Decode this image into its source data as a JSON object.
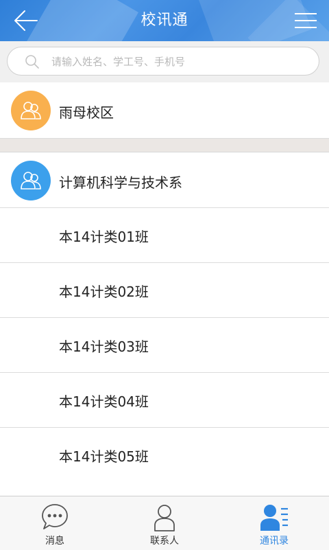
{
  "header": {
    "title": "校讯通"
  },
  "search": {
    "placeholder": "请输入姓名、学工号、手机号"
  },
  "campus": {
    "name": "雨母校区",
    "color": "#f9b04e"
  },
  "department": {
    "name": "计算机科学与技术系",
    "color": "#3ca0ec",
    "classes": [
      "本14计类01班",
      "本14计类02班",
      "本14计类03班",
      "本14计类04班",
      "本14计类05班"
    ]
  },
  "tabbar": {
    "items": [
      {
        "label": "消息",
        "icon": "chat-bubble-icon",
        "active": false
      },
      {
        "label": "联系人",
        "icon": "person-icon",
        "active": false
      },
      {
        "label": "通讯录",
        "icon": "contacts-list-icon",
        "active": true
      }
    ],
    "active_color": "#2f86e0"
  }
}
